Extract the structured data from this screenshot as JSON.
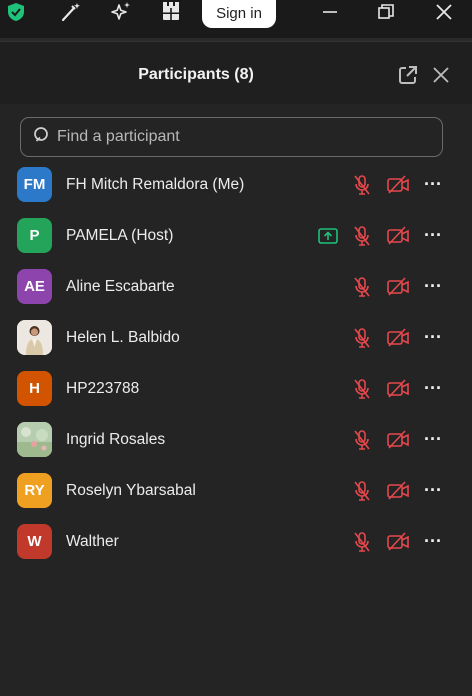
{
  "window": {
    "signin_label": "Sign in",
    "icons": [
      "shield-icon",
      "magic-wand-icon",
      "sparkle-icon",
      "apps-icon"
    ],
    "controls": [
      "minimize-icon",
      "restore-icon",
      "close-icon"
    ]
  },
  "panel": {
    "title": "Participants (8)",
    "header_icons": [
      "pop-out-icon",
      "close-icon"
    ],
    "search_placeholder": "Find a participant"
  },
  "colors": {
    "accent_green": "#1ec27a",
    "muted_red": "#e5484d",
    "background": "#242424"
  },
  "participants": [
    {
      "initials": "FM",
      "name": "FH Mitch Remaldora (Me)",
      "avatar_color": "#2b79c8",
      "sharing": false,
      "photo": false
    },
    {
      "initials": "P",
      "name": "PAMELA (Host)",
      "avatar_color": "#24a35a",
      "sharing": true,
      "photo": false
    },
    {
      "initials": "AE",
      "name": "Aline Escabarte",
      "avatar_color": "#8e44ad",
      "sharing": false,
      "photo": false
    },
    {
      "initials": "",
      "name": "Helen L. Balbido",
      "avatar_color": "#e9e4de",
      "sharing": false,
      "photo": true
    },
    {
      "initials": "H",
      "name": "HP223788",
      "avatar_color": "#d35400",
      "sharing": false,
      "photo": false
    },
    {
      "initials": "",
      "name": "Ingrid Rosales",
      "avatar_color": "#a8c4a0",
      "sharing": false,
      "photo": true
    },
    {
      "initials": "RY",
      "name": "Roselyn Ybarsabal",
      "avatar_color": "#f0a020",
      "sharing": false,
      "photo": false
    },
    {
      "initials": "W",
      "name": "Walther",
      "avatar_color": "#c0392b",
      "sharing": false,
      "photo": false
    }
  ]
}
